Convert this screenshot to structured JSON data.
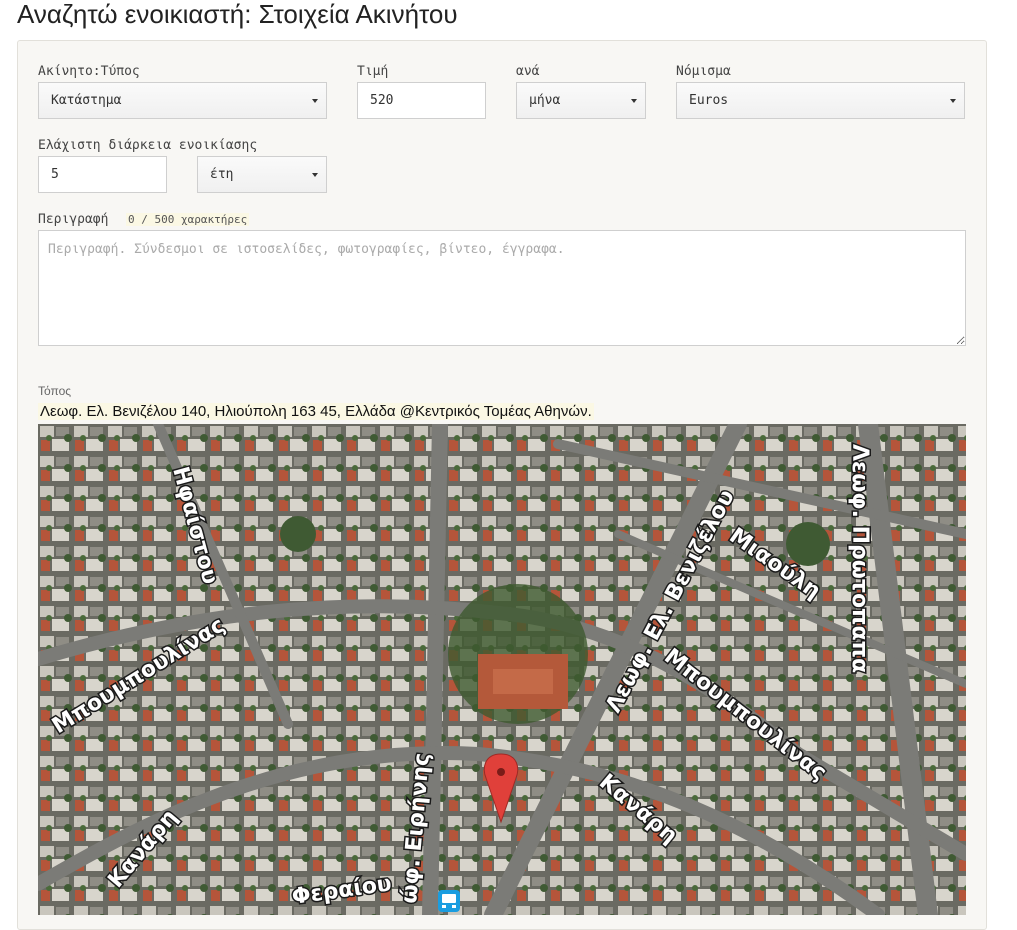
{
  "page": {
    "title": "Αναζητώ ενοικιαστή: Στοιχεία Ακινήτου"
  },
  "form": {
    "property_type": {
      "label": "Ακίνητο:Τύπος",
      "value": "Κατάστημα"
    },
    "price": {
      "label": "Τιμή",
      "value": "520"
    },
    "per": {
      "label": "ανά",
      "value": "μήνα"
    },
    "currency": {
      "label": "Νόμισμα",
      "value": "Euros"
    },
    "min_duration": {
      "label": "Ελάχιστη διάρκεια ενοικίασης",
      "value": "5",
      "unit": "έτη"
    },
    "description": {
      "label": "Περιγραφή",
      "counter": "0 / 500 χαρακτήρες",
      "placeholder": "Περιγραφή. Σύνδεσμοι σε ιστοσελίδες, φωτογραφίες, βίντεο, έγγραφα.",
      "value": ""
    },
    "location": {
      "label": "Τόπος",
      "address": "Λεωφ. Ελ. Βενιζέλου 140, Ηλιούπολη 163 45, Ελλάδα @Κεντρικός Τομέας Αθηνών."
    }
  },
  "map": {
    "streets": {
      "ifaistou": "Ηφαίστου",
      "venizelou": "Λεωφ. Ελ. Βενιζέλου",
      "miaouli": "Μιαούλη",
      "protopapa": "Λεωφ. Πρωτοπαπα",
      "boumpoulinas_left": "Μπουμπουλίνας",
      "boumpoulinas_right": "Μπουμπουλίνας",
      "kanari_left": "Κανάρη",
      "kanari_right": "Κανάρη",
      "eirinis": "ώφ. Ειρήνης",
      "feraiou": "Φεραίου"
    },
    "marker_icon": "map-pin-icon",
    "bus_icon": "bus-stop-icon",
    "colors": {
      "marker": "#e0403a",
      "bus": "#1a9de0"
    }
  }
}
